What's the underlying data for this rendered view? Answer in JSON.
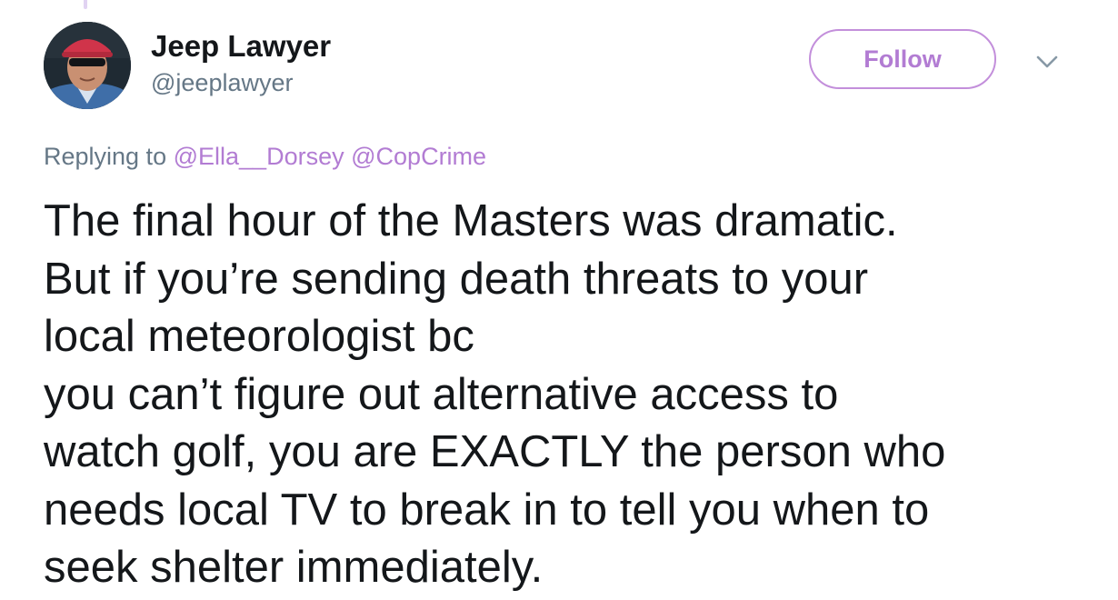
{
  "tweet": {
    "author": {
      "display_name": "Jeep Lawyer",
      "handle": "@jeeplawyer",
      "avatar_icon": "user-photo-avatar"
    },
    "follow_label": "Follow",
    "menu_icon": "chevron-down-icon",
    "reply": {
      "prefix": "Replying to",
      "mentions": [
        "@Ella__Dorsey",
        "@CopCrime"
      ]
    },
    "text_lines": [
      "The final hour of the Masters was dramatic.",
      "But if you’re sending death threats to your",
      "local meteorologist bc",
      "you can’t figure out alternative access to",
      "watch golf, you are EXACTLY the person who",
      "needs local TV to break in to tell you when to",
      "seek shelter immediately."
    ]
  },
  "colors": {
    "accent": "#b27cd3",
    "accent_border": "#c38fdb",
    "secondary_text": "#657786",
    "primary_text": "#14171a"
  }
}
